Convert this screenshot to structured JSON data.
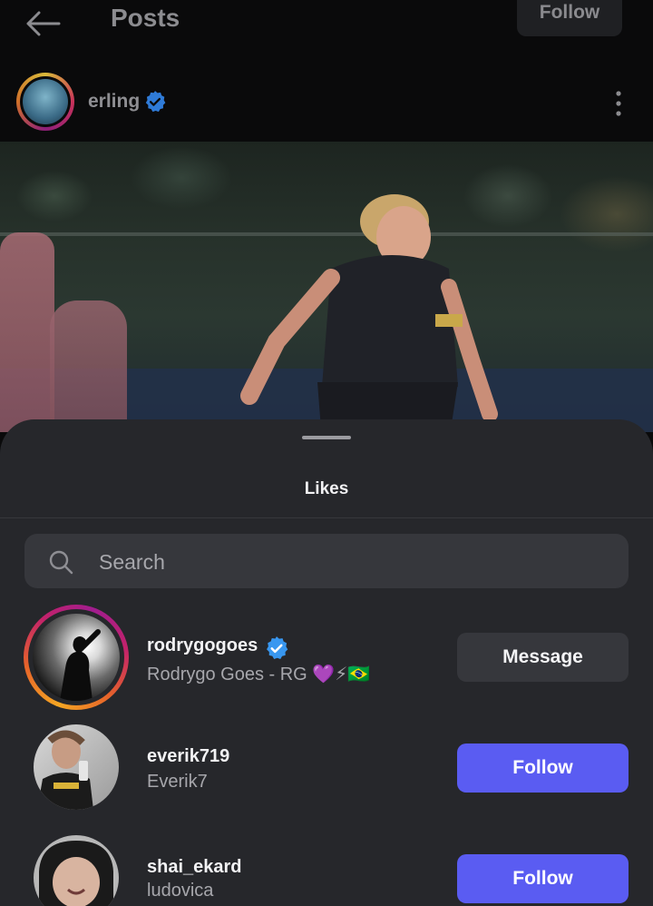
{
  "header": {
    "title": "Posts",
    "follow_label": "Follow"
  },
  "post": {
    "author": "erling",
    "author_verified": true
  },
  "likes_sheet": {
    "title": "Likes",
    "search_placeholder": "Search",
    "search_value": "",
    "users": [
      {
        "handle": "rodrygogoes",
        "verified": true,
        "full_name": "Rodrygo Goes - RG 💜⚡🇧🇷",
        "action_label": "Message",
        "has_story": true
      },
      {
        "handle": "everik719",
        "verified": false,
        "full_name": "Everik7",
        "action_label": "Follow",
        "has_story": false
      },
      {
        "handle": "shai_ekard",
        "verified": false,
        "full_name": "ludovica",
        "action_label": "Follow",
        "has_story": false
      }
    ]
  },
  "colors": {
    "background": "#0a0a0b",
    "sheet": "#26272b",
    "follow_button": "#5a5cf2",
    "secondary_button": "#36373c",
    "verified_badge": "#3897f0",
    "primary_text": "#f2f2f4",
    "secondary_text": "#a7a7ac"
  },
  "icons": {
    "back": "arrow-left-icon",
    "more": "more-vertical-icon",
    "verified": "verified-badge-icon",
    "search": "search-icon"
  }
}
